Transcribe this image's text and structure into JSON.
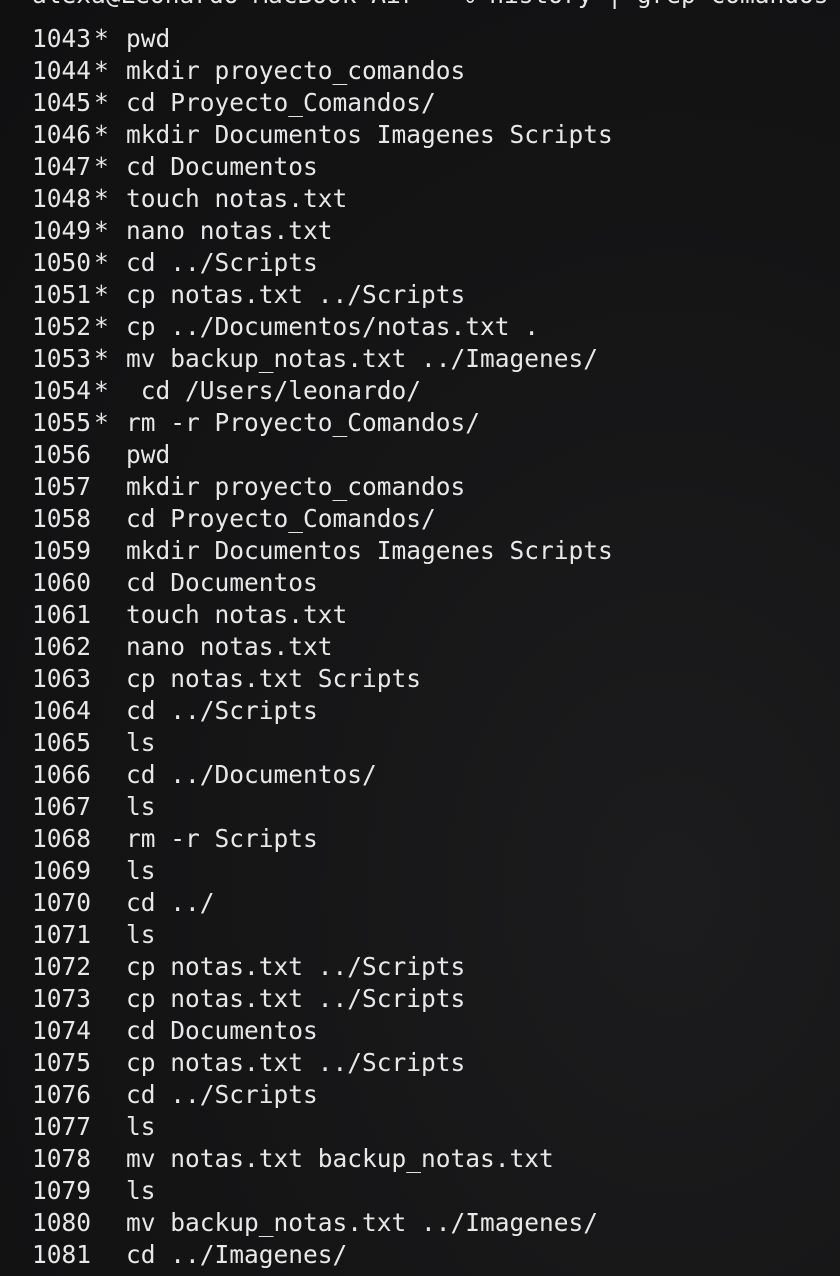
{
  "terminal": {
    "partial_top_line": "alexa@Leonardo-MacBook-Air ~ % history | grep comandos",
    "history": [
      {
        "num": "1043",
        "mark": "*",
        "cmd": "pwd"
      },
      {
        "num": "1044",
        "mark": "*",
        "cmd": "mkdir proyecto_comandos"
      },
      {
        "num": "1045",
        "mark": "*",
        "cmd": "cd Proyecto_Comandos/"
      },
      {
        "num": "1046",
        "mark": "*",
        "cmd": "mkdir Documentos Imagenes Scripts"
      },
      {
        "num": "1047",
        "mark": "*",
        "cmd": "cd Documentos"
      },
      {
        "num": "1048",
        "mark": "*",
        "cmd": "touch notas.txt"
      },
      {
        "num": "1049",
        "mark": "*",
        "cmd": "nano notas.txt"
      },
      {
        "num": "1050",
        "mark": "*",
        "cmd": "cd ../Scripts"
      },
      {
        "num": "1051",
        "mark": "*",
        "cmd": "cp notas.txt ../Scripts"
      },
      {
        "num": "1052",
        "mark": "*",
        "cmd": "cp ../Documentos/notas.txt ."
      },
      {
        "num": "1053",
        "mark": "*",
        "cmd": "mv backup_notas.txt ../Imagenes/"
      },
      {
        "num": "1054",
        "mark": "*",
        "cmd": " cd /Users/leonardo/"
      },
      {
        "num": "1055",
        "mark": "*",
        "cmd": "rm -r Proyecto_Comandos/"
      },
      {
        "num": "1056",
        "mark": "",
        "cmd": "pwd"
      },
      {
        "num": "1057",
        "mark": "",
        "cmd": "mkdir proyecto_comandos"
      },
      {
        "num": "1058",
        "mark": "",
        "cmd": "cd Proyecto_Comandos/"
      },
      {
        "num": "1059",
        "mark": "",
        "cmd": "mkdir Documentos Imagenes Scripts"
      },
      {
        "num": "1060",
        "mark": "",
        "cmd": "cd Documentos"
      },
      {
        "num": "1061",
        "mark": "",
        "cmd": "touch notas.txt"
      },
      {
        "num": "1062",
        "mark": "",
        "cmd": "nano notas.txt"
      },
      {
        "num": "1063",
        "mark": "",
        "cmd": "cp notas.txt Scripts"
      },
      {
        "num": "1064",
        "mark": "",
        "cmd": "cd ../Scripts"
      },
      {
        "num": "1065",
        "mark": "",
        "cmd": "ls"
      },
      {
        "num": "1066",
        "mark": "",
        "cmd": "cd ../Documentos/"
      },
      {
        "num": "1067",
        "mark": "",
        "cmd": "ls"
      },
      {
        "num": "1068",
        "mark": "",
        "cmd": "rm -r Scripts"
      },
      {
        "num": "1069",
        "mark": "",
        "cmd": "ls"
      },
      {
        "num": "1070",
        "mark": "",
        "cmd": "cd ../"
      },
      {
        "num": "1071",
        "mark": "",
        "cmd": "ls"
      },
      {
        "num": "1072",
        "mark": "",
        "cmd": "cp notas.txt ../Scripts"
      },
      {
        "num": "1073",
        "mark": "",
        "cmd": "cp notas.txt ../Scripts"
      },
      {
        "num": "1074",
        "mark": "",
        "cmd": "cd Documentos"
      },
      {
        "num": "1075",
        "mark": "",
        "cmd": "cp notas.txt ../Scripts"
      },
      {
        "num": "1076",
        "mark": "",
        "cmd": "cd ../Scripts"
      },
      {
        "num": "1077",
        "mark": "",
        "cmd": "ls"
      },
      {
        "num": "1078",
        "mark": "",
        "cmd": "mv notas.txt backup_notas.txt"
      },
      {
        "num": "1079",
        "mark": "",
        "cmd": "ls"
      },
      {
        "num": "1080",
        "mark": "",
        "cmd": "mv backup_notas.txt ../Imagenes/"
      },
      {
        "num": "1081",
        "mark": "",
        "cmd": "cd ../Imagenes/"
      }
    ]
  }
}
